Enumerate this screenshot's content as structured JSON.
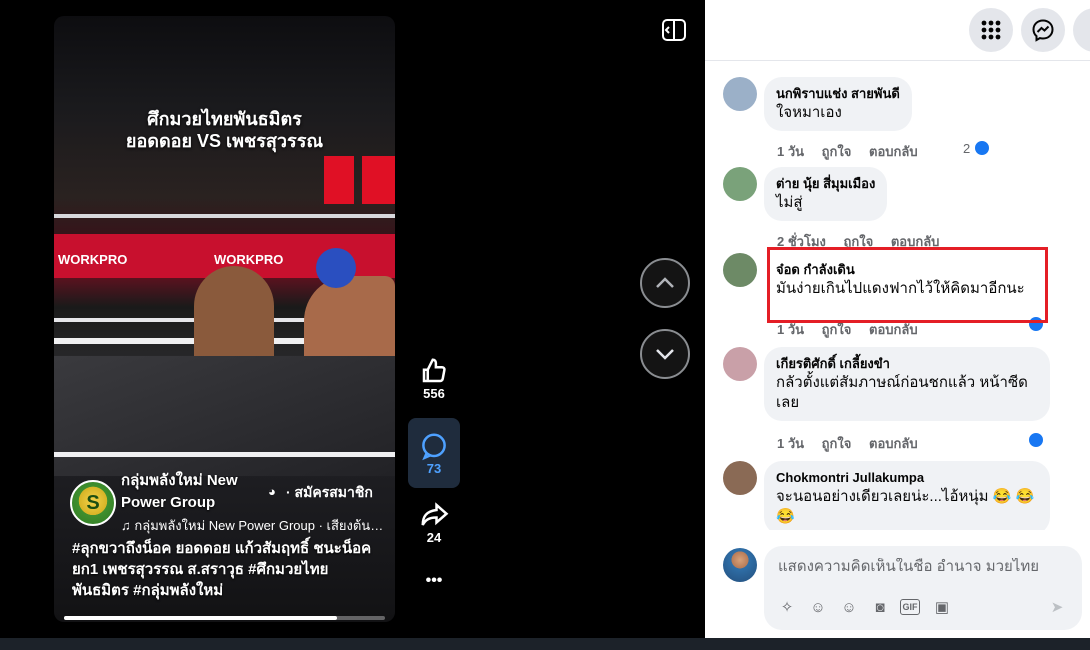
{
  "video": {
    "title": "ศึกมวยไทยพันธมิตร\nยอดดอย VS เพชรสุวรรณ",
    "ring_banner_left": "WORKPRO",
    "ring_banner_right": "WORKPRO",
    "page_name": "กลุ่มพลังใหม่ New Power Group",
    "avatar_text": "S",
    "member_text": "· สมัครสมาชิก",
    "music_line": "♫ กลุ่มพลังใหม่ New Power Group · เสียงต้นฉบับ",
    "caption": "#ลุกขวาถึงน็อค ยอดดอย แก้วสัมฤทธิ์ ชนะน็อคยก1 เพชรสุวรรณ ส.สราวุธ #ศึกมวยไทยพันธมิตร #กลุ่มพลังใหม่",
    "progress": 0.85
  },
  "rail": {
    "likes": "556",
    "comments": "73",
    "shares": "24",
    "more": "•••"
  },
  "comments": [
    {
      "name": "นกพิราบแช่ง สายพันดี",
      "text": "ใจหมาเอง",
      "time": "1 วัน",
      "like": "ถูกใจ",
      "reply": "ตอบกลับ",
      "reactions": "2",
      "avatar_color": "#9bb0c8"
    },
    {
      "name": "ต่าย นุ้ย สี่มุมเมือง",
      "text": "ไม่สู่",
      "time": "2 ชั่วโมง",
      "like": "ถูกใจ",
      "reply": "ตอบกลับ",
      "reactions": "",
      "avatar_color": "#7aa27a"
    },
    {
      "name": "จ๋อด กำลังเดิน",
      "text": "มันง่ายเกินไปแดงฟากไว้ให้คิดมาอีกนะ",
      "time": "1 วัน",
      "like": "ถูกใจ",
      "reply": "ตอบกลับ",
      "reactions": "",
      "avatar_color": "#6d8a66"
    },
    {
      "name": "เกียรติศักดิ์ เกลี้ยงขำ",
      "text": "กลัวตั้งแต่สัมภาษณ์ก่อนชกแล้ว หน้าซีดเลย",
      "time": "1 วัน",
      "like": "ถูกใจ",
      "reply": "ตอบกลับ",
      "reactions": "",
      "avatar_color": "#c9a0a8"
    },
    {
      "name": "Chokmontri Jullakumpa",
      "text": "จะนอนอย่างเดียวเลยน่ะ...ไอ้หนุ่ม 😂 😂😂",
      "time": "",
      "like": "",
      "reply": "",
      "reactions": "",
      "avatar_color": "#8a6a55"
    }
  ],
  "composer": {
    "placeholder": "แสดงความคิดเห็นในชื่อ อำนาจ มวยไทย"
  },
  "colors": {
    "accent": "#1877f2",
    "highlight": "#e41e26"
  }
}
